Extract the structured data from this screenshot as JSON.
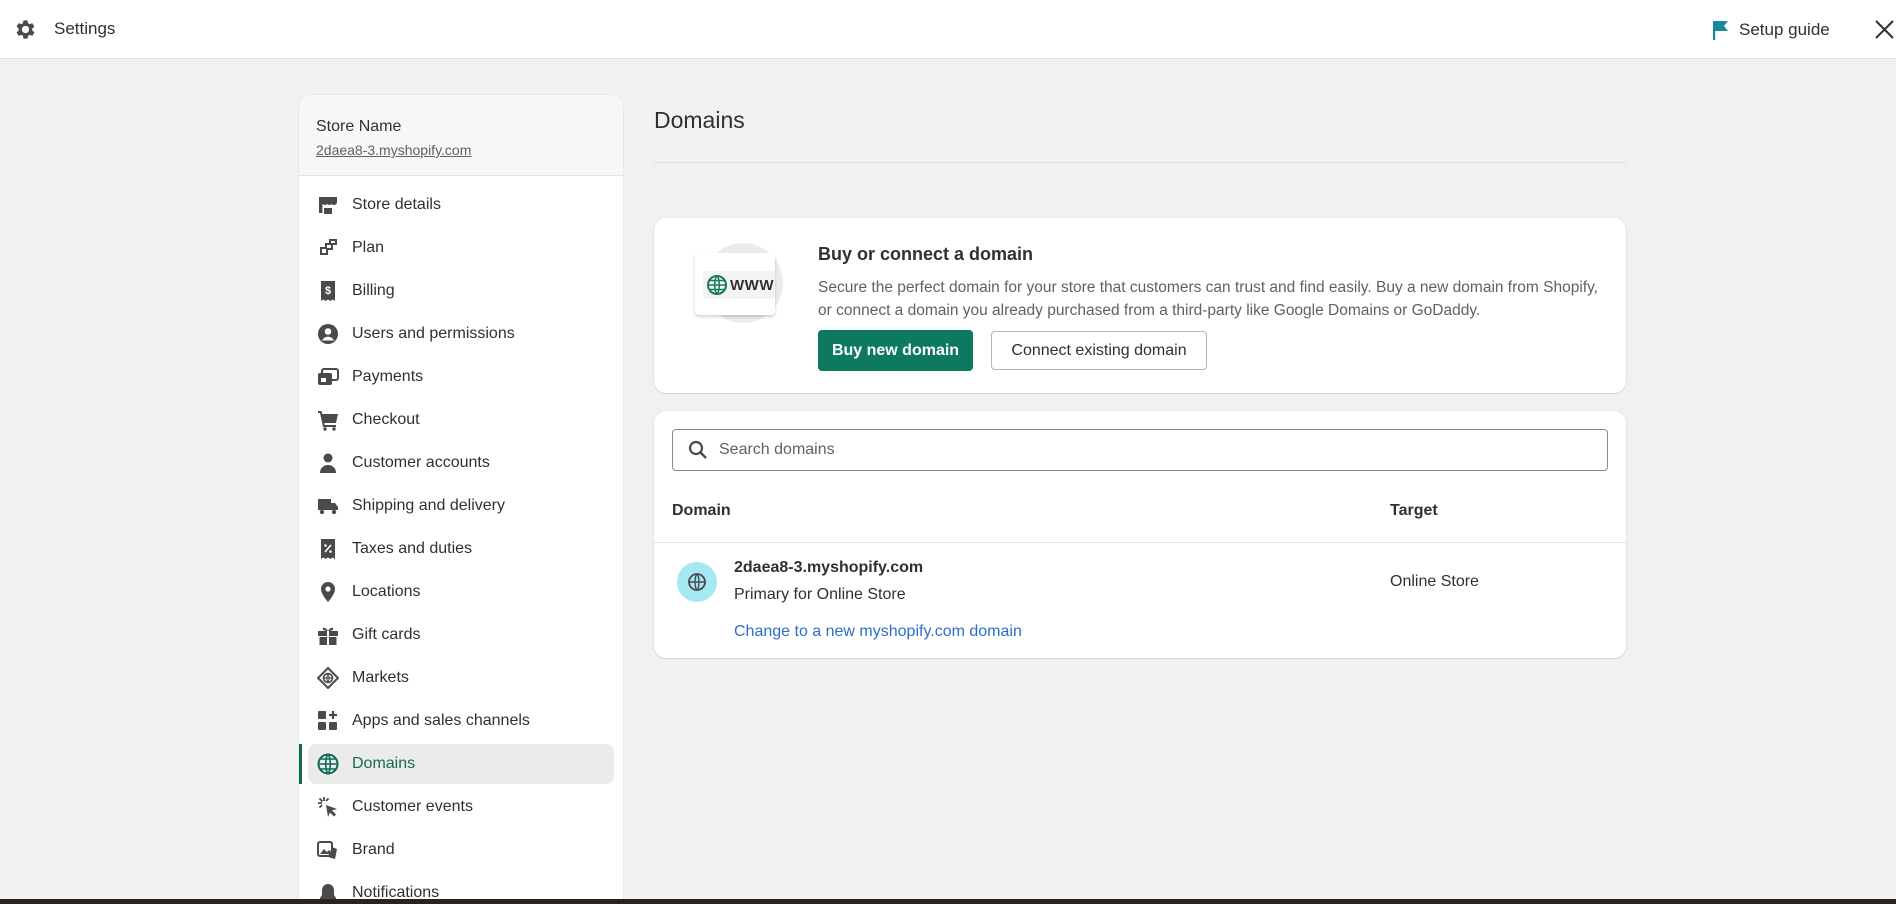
{
  "topbar": {
    "title": "Settings",
    "setup_guide": "Setup guide"
  },
  "sidebar": {
    "store_name": "Store Name",
    "store_url": "2daea8-3.myshopify.com",
    "items": [
      {
        "label": "Store details",
        "icon": "store-icon"
      },
      {
        "label": "Plan",
        "icon": "plan-icon"
      },
      {
        "label": "Billing",
        "icon": "billing-icon"
      },
      {
        "label": "Users and permissions",
        "icon": "user-circle-icon"
      },
      {
        "label": "Payments",
        "icon": "payments-icon"
      },
      {
        "label": "Checkout",
        "icon": "cart-icon"
      },
      {
        "label": "Customer accounts",
        "icon": "person-icon"
      },
      {
        "label": "Shipping and delivery",
        "icon": "truck-icon"
      },
      {
        "label": "Taxes and duties",
        "icon": "tax-icon"
      },
      {
        "label": "Locations",
        "icon": "location-pin-icon"
      },
      {
        "label": "Gift cards",
        "icon": "gift-icon"
      },
      {
        "label": "Markets",
        "icon": "markets-globe-icon"
      },
      {
        "label": "Apps and sales channels",
        "icon": "apps-icon"
      },
      {
        "label": "Domains",
        "icon": "globe-icon",
        "active": true
      },
      {
        "label": "Customer events",
        "icon": "cursor-click-icon"
      },
      {
        "label": "Brand",
        "icon": "brand-icon"
      },
      {
        "label": "Notifications",
        "icon": "bell-icon"
      }
    ]
  },
  "main": {
    "title": "Domains",
    "buy_card": {
      "illustration_text": "WWW",
      "title": "Buy or connect a domain",
      "description": "Secure the perfect domain for your store that customers can trust and find easily. Buy a new domain from Shopify, or connect a domain you already purchased from a third-party like Google Domains or GoDaddy.",
      "primary_button": "Buy new domain",
      "secondary_button": "Connect existing domain"
    },
    "domains": {
      "search_placeholder": "Search domains",
      "columns": [
        "Domain",
        "Target"
      ],
      "rows": [
        {
          "domain": "2daea8-3.myshopify.com",
          "subtitle": "Primary for Online Store",
          "link": "Change to a new myshopify.com domain",
          "target": "Online Store"
        }
      ]
    }
  },
  "colors": {
    "accent": "#0d7a5f",
    "active_nav_text": "#0f6b55",
    "link": "#2c6ecb",
    "globe_badge": "#a4e8f2",
    "background": "#f1f1f1"
  }
}
